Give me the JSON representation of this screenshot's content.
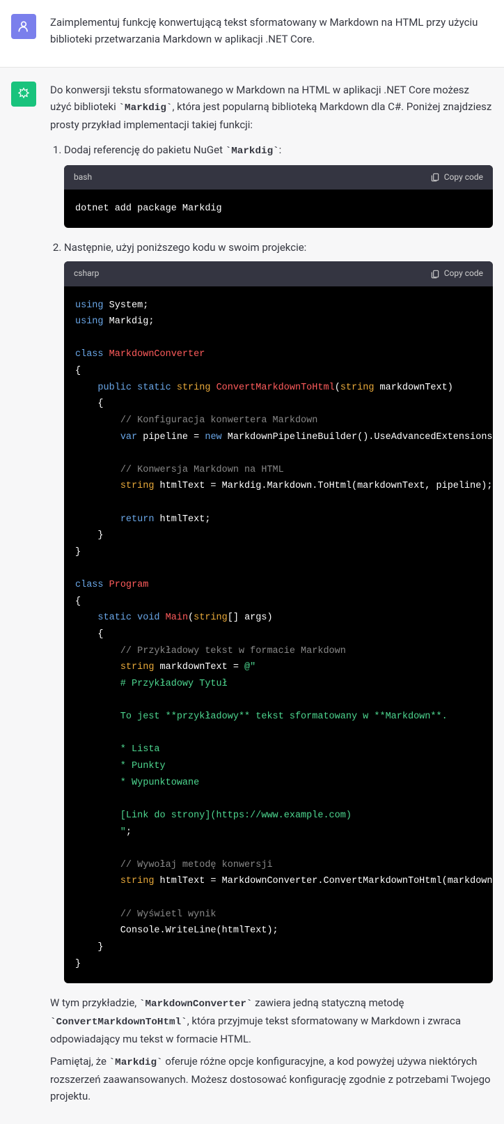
{
  "user_message": "Zaimplementuj funkcję konwertującą tekst sformatowany w Markdown na HTML przy użyciu biblioteki przetwarzania Markdown w aplikacji .NET Core.",
  "assistant": {
    "intro_p1_a": "Do konwersji tekstu sformatowanego w Markdown na HTML w aplikacji .NET Core możesz użyć biblioteki ",
    "intro_code1": "`Markdig`",
    "intro_p1_b": ", która jest popularną biblioteką Markdown dla C#. Poniżej znajdziesz prosty przykład implementacji takiej funkcji:",
    "step1_a": "Dodaj referencję do pakietu NuGet ",
    "step1_code": "`Markdig`",
    "step1_b": ":",
    "code1_lang": "bash",
    "copy_label": "Copy code",
    "code1_body": "dotnet add package Markdig",
    "step2": "Następnie, użyj poniższego kodu w swoim projekcie:",
    "code2_lang": "csharp",
    "code2": {
      "using": "using",
      "system": " System;",
      "markdig": " Markdig;",
      "class": "class",
      "mc": " MarkdownConverter",
      "public": "public",
      "static": "static",
      "string": "string",
      "void": "void",
      "convert": "ConvertMarkdownToHtml",
      "param1": " markdownText)",
      "comment1": "// Konfiguracja konwertera Markdown",
      "var": "var",
      "pipeline": " pipeline = ",
      "new": "new",
      "mpb": " MarkdownPipelineBuilder().UseAdvancedExtensions().Build();",
      "comment2": "// Konwersja Markdown na HTML",
      "htmlline": " htmlText = Markdig.Markdown.ToHtml(markdownText, pipeline);",
      "return": "return",
      "rettext": " htmlText;",
      "program": " Program",
      "main": "Main",
      "mainargs": "[] args)",
      "comment3": "// Przykładowy tekst w formacie Markdown",
      "mdtext": " markdownText = ",
      "at": "@\"",
      "s1": "        # Przykładowy Tytuł",
      "s2": "        To jest **przykładowy** tekst sformatowany w **Markdown**.",
      "s3": "        * Lista",
      "s4": "        * Punkty",
      "s5": "        * Wypunktowane",
      "s6": "        [Link do strony](https://www.example.com)",
      "s7": "        \"",
      "semi": ";",
      "comment4": "// Wywołaj metodę konwersji",
      "callline": " htmlText = MarkdownConverter.ConvertMarkdownToHtml(markdownText);",
      "comment5": "// Wyświetl wynik",
      "console": "        Console.WriteLine(htmlText);"
    },
    "outro1_a": "W tym przykładzie, ",
    "outro1_code1": "`MarkdownConverter`",
    "outro1_b": " zawiera jedną statyczną metodę ",
    "outro1_code2": "`ConvertMarkdownToHtml`",
    "outro1_c": ", która przyjmuje tekst sformatowany w Markdown i zwraca odpowiadający mu tekst w formacie HTML.",
    "outro2_a": "Pamiętaj, że ",
    "outro2_code": "`Markdig`",
    "outro2_b": " oferuje różne opcje konfiguracyjne, a kod powyżej używa niektórych rozszerzeń zaawansowanych. Możesz dostosować konfigurację zgodnie z potrzebami Twojego projektu."
  }
}
